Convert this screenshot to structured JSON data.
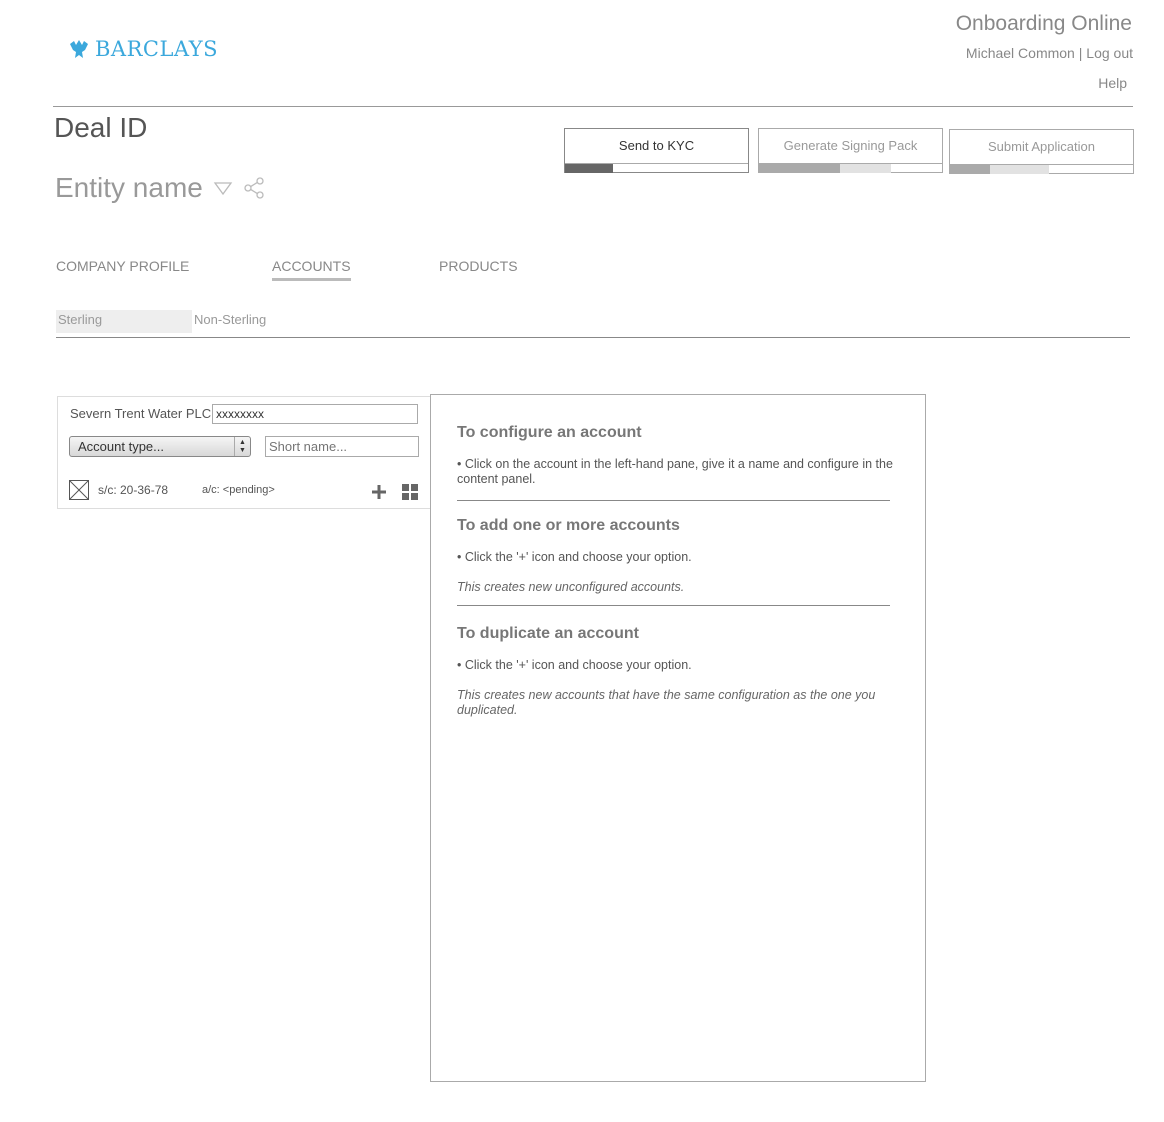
{
  "header": {
    "brand": "BARCLAYS",
    "app_title": "Onboarding Online",
    "user_name": "Michael Common",
    "separator": " | ",
    "logout": "Log out",
    "help": "Help"
  },
  "deal": {
    "title": "Deal ID",
    "entity_name": "Entity name"
  },
  "actions": [
    {
      "label": "Send to KYC",
      "progress": 0.25
    },
    {
      "label": "Generate Signing Pack",
      "progress": 0.45
    },
    {
      "label": "Submit Application",
      "progress": 0.22
    }
  ],
  "tabs": [
    {
      "label": "COMPANY PROFILE"
    },
    {
      "label": "ACCOUNTS",
      "active": true
    },
    {
      "label": "PRODUCTS"
    }
  ],
  "subtabs": [
    {
      "label": "Sterling",
      "active": true
    },
    {
      "label": "Non-Sterling"
    }
  ],
  "account": {
    "company": "Severn Trent Water PLC",
    "account_value": "xxxxxxxx",
    "account_type_placeholder": "Account type...",
    "short_name_placeholder": "Short name...",
    "sort_code": "s/c: 20-36-78",
    "account_number": "a/c: <pending>"
  },
  "help_panel": {
    "sections": [
      {
        "heading": "To configure an account",
        "text": "• Click on the account in the left-hand pane, give it a name and configure in the content panel."
      },
      {
        "heading": "To add one or more accounts",
        "text": "• Click the '+' icon and choose your option.",
        "note": "This creates new unconfigured accounts."
      },
      {
        "heading": "To duplicate an account",
        "text": "• Click the '+' icon and choose your option.",
        "note": "This creates new accounts that have the same configuration as the one you duplicated."
      }
    ]
  },
  "colors": {
    "brand": "#3ba8dc",
    "progress_dark": "#666666",
    "progress_mid": "#aaaaaa",
    "progress_light": "#e2e2e2"
  }
}
